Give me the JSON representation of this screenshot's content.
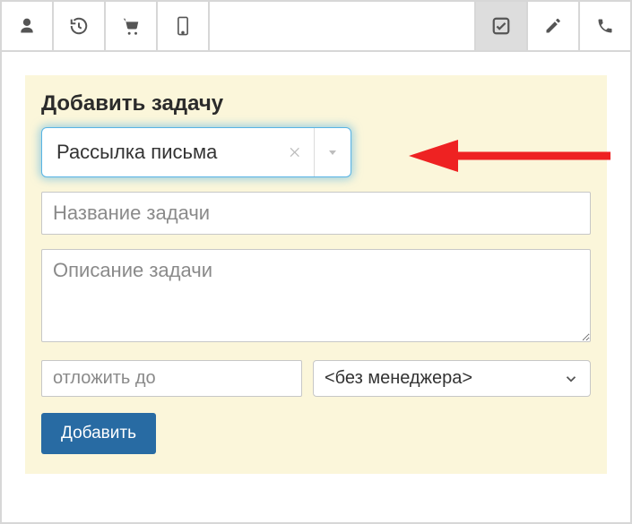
{
  "toolbar": {
    "left_icons": [
      "user-icon",
      "history-icon",
      "cart-icon",
      "mobile-icon"
    ],
    "right_icons": [
      "check-icon",
      "edit-icon",
      "phone-icon"
    ],
    "active_right_index": 0
  },
  "panel": {
    "title": "Добавить задачу",
    "task_type": {
      "value": "Рассылка письма"
    },
    "task_name": {
      "placeholder": "Название задачи",
      "value": ""
    },
    "task_description": {
      "placeholder": "Описание задачи",
      "value": ""
    },
    "defer_until": {
      "placeholder": "отложить до",
      "value": ""
    },
    "manager": {
      "selected": "<без менеджера>"
    },
    "submit_label": "Добавить"
  }
}
